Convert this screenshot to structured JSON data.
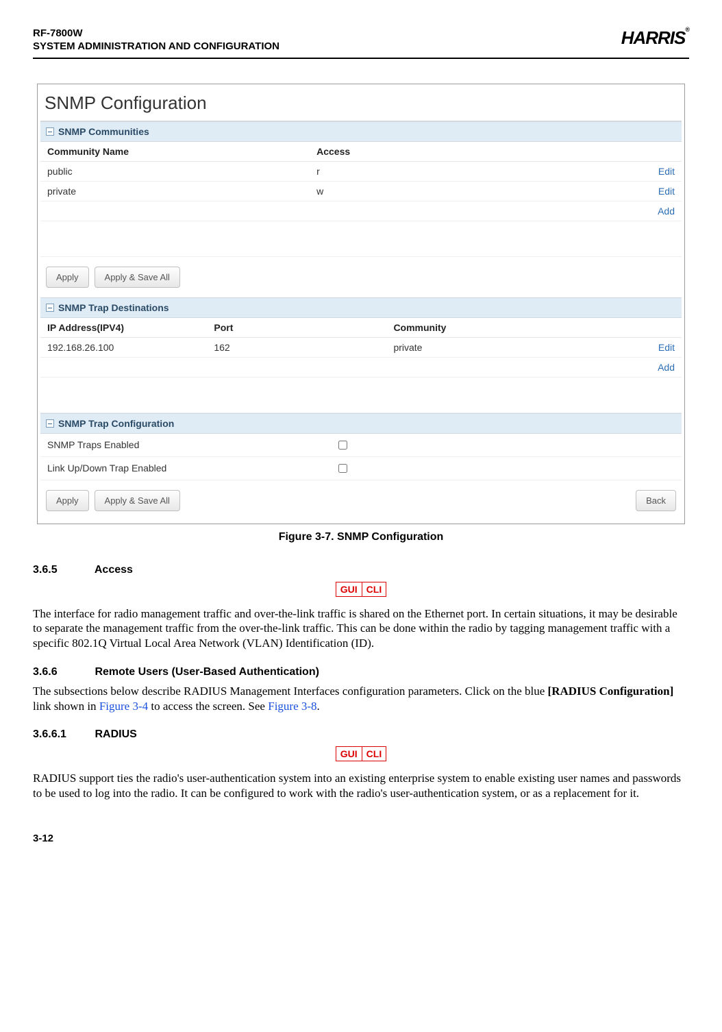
{
  "header": {
    "model": "RF-7800W",
    "subtitle": "SYSTEM ADMINISTRATION AND CONFIGURATION",
    "brand": "HARRIS",
    "reg": "®"
  },
  "screenshot": {
    "title": "SNMP Configuration",
    "communities": {
      "header": "SNMP Communities",
      "cols": {
        "name": "Community Name",
        "access": "Access"
      },
      "rows": [
        {
          "name": "public",
          "access": "r",
          "action": "Edit"
        },
        {
          "name": "private",
          "access": "w",
          "action": "Edit"
        }
      ],
      "add": "Add"
    },
    "buttons": {
      "apply": "Apply",
      "applysave": "Apply & Save All",
      "back": "Back"
    },
    "traps": {
      "header": "SNMP Trap Destinations",
      "cols": {
        "ip": "IP Address(IPV4)",
        "port": "Port",
        "community": "Community"
      },
      "rows": [
        {
          "ip": "192.168.26.100",
          "port": "162",
          "community": "private",
          "action": "Edit"
        }
      ],
      "add": "Add"
    },
    "trapcfg": {
      "header": "SNMP Trap Configuration",
      "rows": [
        {
          "label": "SNMP Traps Enabled"
        },
        {
          "label": "Link Up/Down Trap Enabled"
        }
      ]
    }
  },
  "figure_caption": "Figure 3-7.  SNMP Configuration",
  "sections": {
    "s365": {
      "num": "3.6.5",
      "title": "Access"
    },
    "s366": {
      "num": "3.6.6",
      "title": "Remote Users (User-Based Authentication)"
    },
    "s3661": {
      "num": "3.6.6.1",
      "title": "RADIUS"
    }
  },
  "badges": {
    "gui": "GUI",
    "cli": "CLI"
  },
  "paragraphs": {
    "p1": "The interface for radio management traffic and over-the-link traffic is shared on the Ethernet port. In certain situations, it may be desirable to separate the management traffic from the over-the-link traffic. This can be done within the radio by tagging management traffic with a specific 802.1Q Virtual Local Area Network (VLAN) Identification (ID).",
    "p2a": "The subsections below describe RADIUS Management Interfaces configuration parameters. Click on the blue ",
    "p2b": "[RADIUS Configuration]",
    "p2c": " link shown in ",
    "p2d": "Figure 3-4",
    "p2e": " to access the screen. See ",
    "p2f": "Figure 3-8",
    "p2g": ".",
    "p3": "RADIUS support ties the radio's user-authentication system into an existing enterprise system to enable existing user names and passwords to be used to log into the radio. It can be configured to work with the radio's user-authentication system, or as a replacement for it."
  },
  "page_number": "3-12"
}
